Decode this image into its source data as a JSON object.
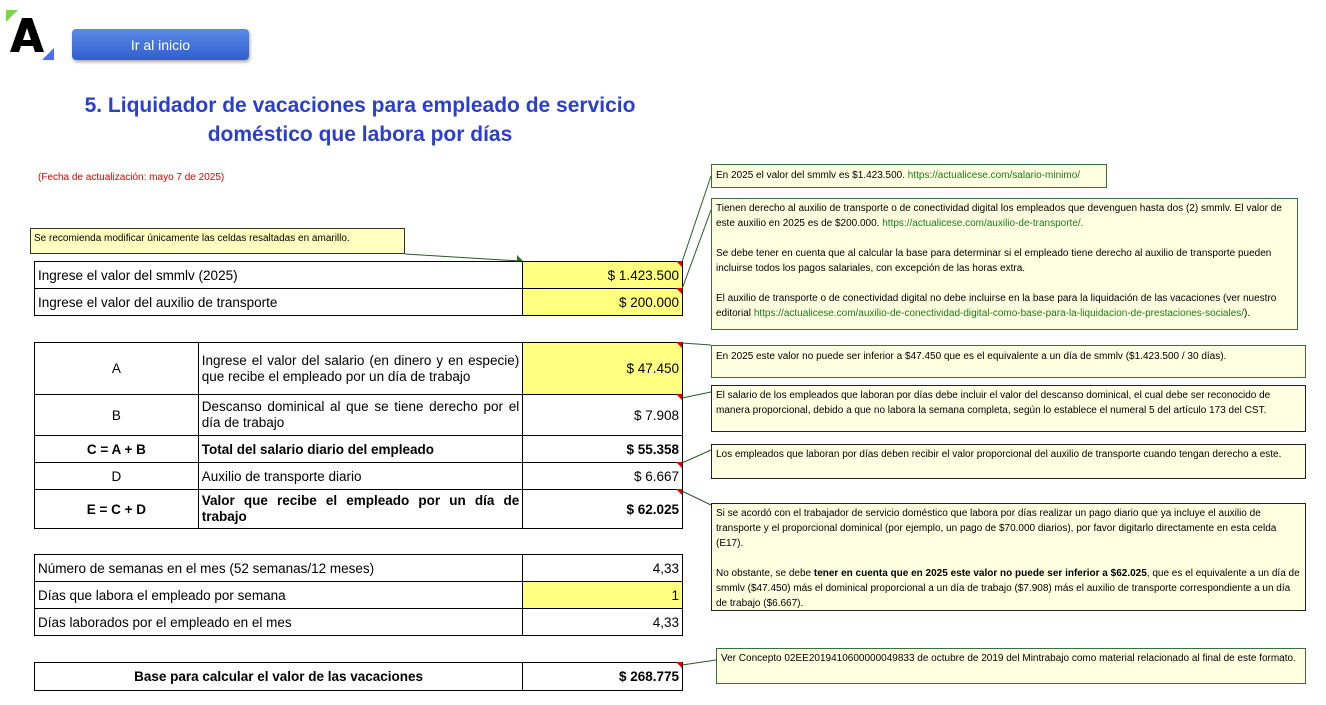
{
  "header": {
    "home_button": "Ir al inicio"
  },
  "title_line1": "5. Liquidador de vacaciones para empleado de servicio",
  "title_line2": "doméstico que labora por días",
  "update_note": "(Fecha de actualización: mayo 7 de 2025)",
  "yellow_note": "Se recomienda modificar únicamente las celdas resaltadas en amarillo.",
  "inputs": {
    "smmlv_label": "Ingrese el valor del smmlv (2025)",
    "smmlv_value": "$ 1.423.500",
    "aux_label": "Ingrese el valor del auxilio de transporte",
    "aux_value": "$ 200.000"
  },
  "calc": {
    "a_code": "A",
    "a_label": "Ingrese el valor del salario (en dinero y en especie) que recibe el empleado por un día de trabajo",
    "a_value": "$ 47.450",
    "b_code": "B",
    "b_label": "Descanso dominical al que se tiene derecho por el día de trabajo",
    "b_value": "$ 7.908",
    "c_code": "C = A + B",
    "c_label": "Total del salario diario del empleado",
    "c_value": "$ 55.358",
    "d_code": "D",
    "d_label": "Auxilio de transporte diario",
    "d_value": "$ 6.667",
    "e_code": "E = C + D",
    "e_label": "Valor que recibe el empleado por un día de trabajo",
    "e_value": "$ 62.025"
  },
  "weeks": {
    "weeks_label": "Número de semanas en el mes (52 semanas/12 meses)",
    "weeks_value": "4,33",
    "days_label": "Días que labora el empleado por semana",
    "days_value": "1",
    "worked_label": "Días laborados por el empleado en el mes",
    "worked_value": "4,33"
  },
  "base": {
    "label": "Base para calcular el valor de las vacaciones",
    "value": "$ 268.775"
  },
  "comments": {
    "c1_text": "En 2025 el valor del smmlv es $1.423.500. ",
    "c1_link": "https://actualicese.com/salario-minimo/",
    "c2_p1": "Tienen derecho al auxilio de transporte o de conectividad digital los empleados que devenguen hasta dos (2) smmlv. El valor de este auxilio en 2025 es de $200.000. ",
    "c2_link1": "https://actualicese.com/auxilio-de-transporte/.",
    "c2_p2": "Se debe tener en cuenta que al calcular la base para determinar si el empleado tiene derecho al auxilio de transporte pueden incluirse todos los pagos salariales, con excepción de las horas extra.",
    "c2_p3": "El auxilio de transporte o de conectividad digital no debe incluirse en la base para la liquidación de las vacaciones (ver nuestro editorial ",
    "c2_link2": "https://actualicese.com/auxilio-de-conectividad-digital-como-base-para-la-liquidacion-de-prestaciones-sociales/",
    "c2_end": ").",
    "c3_text": "En 2025 este valor no puede ser inferior a $47.450 que es el equivalente a un día de smmlv ($1.423.500 / 30 días).",
    "c4_text": "El salario de los empleados que laboran por días debe incluir el valor del descanso dominical, el cual debe ser reconocido de manera proporcional, debido a que no labora la semana completa, según lo establece el numeral 5 del artículo 173 del CST.",
    "c5_text": "Los empleados que laboran por días deben recibir el valor proporcional del auxilio de transporte cuando tengan derecho a este.",
    "c6_p1": "Si se acordó con el trabajador de servicio doméstico que labora por días realizar un pago diario que ya incluye el auxilio de transporte y el proporcional dominical (por ejemplo, un pago de $70.000 diarios), por favor digitarlo directamente en esta celda (E17).",
    "c6_p2a": "No obstante, se debe ",
    "c6_p2b": "tener en cuenta que en 2025 este valor no puede ser inferior a $62.025",
    "c6_p2c": ", que es el equivalente a un día de smmlv ($47.450) más el dominical proporcional a un día de trabajo ($7.908) más el auxilio de transporte correspondiente a un día de trabajo ($6.667).",
    "c7_text": "Ver Concepto 02EE2019410600000049833 de octubre de 2019 del Mintrabajo como material relacionado al final de este formato."
  },
  "colors": {
    "title": "#2a3fd0",
    "input_cell": "#ffff80",
    "comment_bg": "#ffffe1",
    "link": "#1a7a1a",
    "update_note": "#e00000"
  }
}
